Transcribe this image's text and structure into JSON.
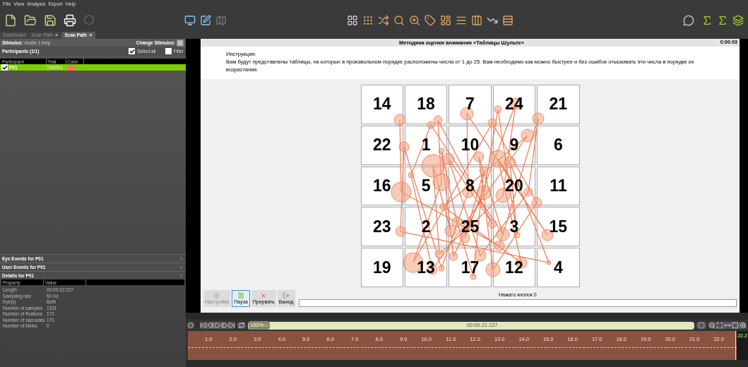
{
  "menu": [
    "File",
    "View",
    "Analysis",
    "Export",
    "Help"
  ],
  "tabs": [
    {
      "label": "Dashboard",
      "selected": false
    },
    {
      "label": "Scan Path",
      "selected": false,
      "close": "×"
    },
    {
      "label": "Scan Path",
      "selected": true,
      "close": "×"
    }
  ],
  "left_panel": {
    "stimulus_label": "Stimulus:",
    "stimulus": "shulte 1.bmp",
    "change_stimulus": "Change Stimulus:",
    "participants_title": "Participants (1/1)",
    "select_all": {
      "label": "Select all",
      "checked": true
    },
    "filter": {
      "label": "Filter",
      "checked": false
    },
    "columns": [
      "Participant",
      "Trial",
      "Color"
    ],
    "rows": [
      {
        "participant": "P01",
        "trial": "Trial001",
        "color": "#f07850",
        "checked": true,
        "selected": true
      }
    ],
    "sections": [
      {
        "title": "Eye Events for P01",
        "expanded": false
      },
      {
        "title": "User Events for P01",
        "expanded": false
      },
      {
        "title": "Details for P01",
        "expanded": true
      }
    ],
    "details": {
      "columns": [
        "Property",
        "Value"
      ],
      "rows": [
        {
          "property": "Length",
          "value": "00:00:22:227"
        },
        {
          "property": "Sampling rate",
          "value": "60 Hz"
        },
        {
          "property": "Eye(s)",
          "value": "Both"
        },
        {
          "property": "Number of samples",
          "value": "1331"
        },
        {
          "property": "Number of fixations",
          "value": "172"
        },
        {
          "property": "Number of saccades",
          "value": "170"
        },
        {
          "property": "Number of blinks",
          "value": "0"
        }
      ]
    }
  },
  "stimulus": {
    "title": "Методика оценки внимания «Таблицы Шульте»",
    "time": "0:00:03",
    "instruction_label": "Инструкция:",
    "instruction": "Вам будут представлены таблицы, на которых в произвольном порядке расположены числа от 1 до 25. Вам необходимо как можно быстрее и без ошибок отыскивать эти числа в порядке их возрастания.",
    "grid": [
      "14",
      "18",
      "7",
      "24",
      "21",
      "22",
      "1",
      "10",
      "9",
      "6",
      "16",
      "5",
      "8",
      "20",
      "11",
      "23",
      "2",
      "25",
      "3",
      "15",
      "19",
      "13",
      "17",
      "12",
      "4"
    ],
    "buttons": [
      {
        "label": "Настройки",
        "selected": false,
        "disabled": true
      },
      {
        "label": "Пауза",
        "selected": true,
        "disabled": false
      },
      {
        "label": "Прервать",
        "selected": false,
        "disabled": false
      },
      {
        "label": "Выход",
        "selected": false,
        "disabled": false
      }
    ],
    "pressed": "Нажато кнопок 0"
  },
  "playback": {
    "zoom": "100%",
    "time": "00:00.22.227"
  },
  "timeline": {
    "ticks": [
      "1.0",
      "2.0",
      "3.0",
      "4.0",
      "5.0",
      "6.0",
      "7.0",
      "8.0",
      "9.0",
      "10.0",
      "11.0",
      "12.0",
      "13.0",
      "14.0",
      "15.0",
      "16.0",
      "17.0",
      "18.0",
      "19.0",
      "20.0",
      "21.0",
      "22.0"
    ],
    "current": "22.2"
  }
}
